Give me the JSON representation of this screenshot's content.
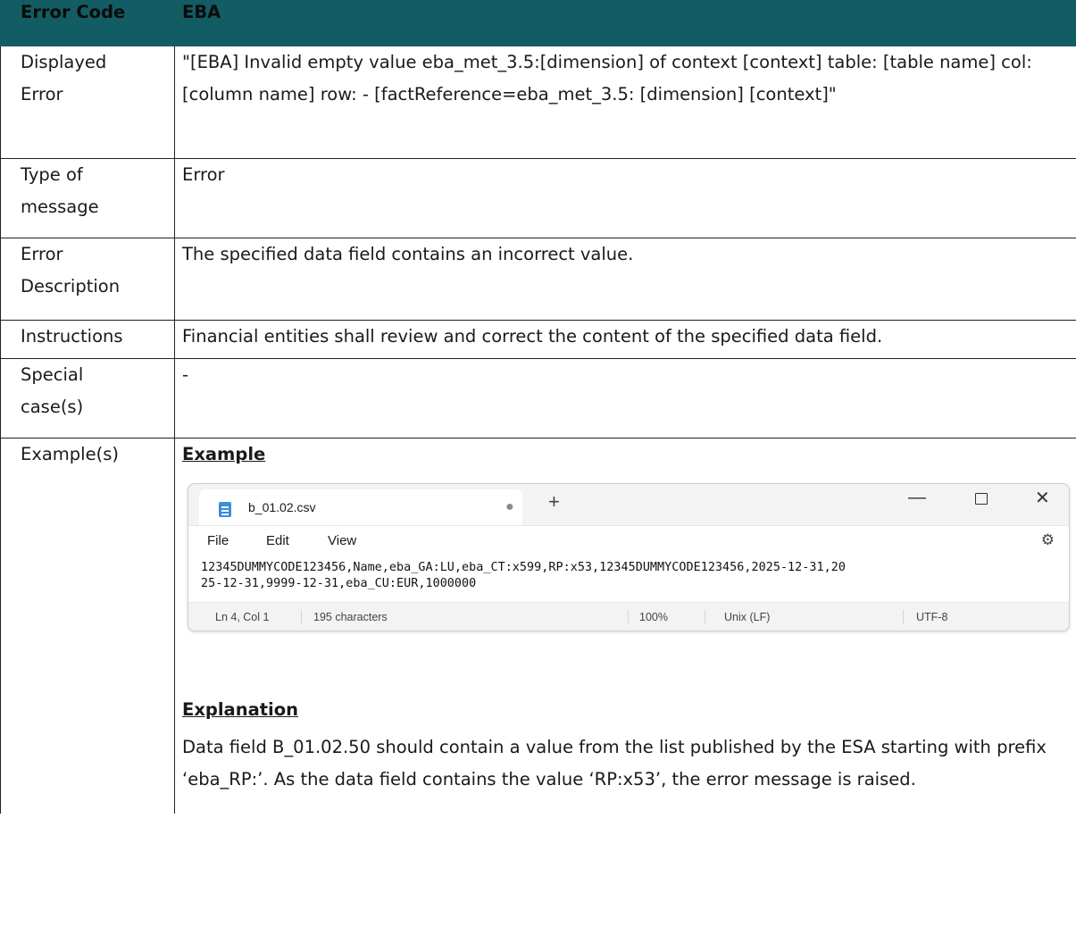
{
  "header": {
    "col1": "Error Code",
    "col2": "EBA"
  },
  "rows": {
    "displayed_error": {
      "label_line1": "Displayed",
      "label_line2": "Error",
      "value": "\"[EBA] Invalid empty value eba_met_3.5:[dimension] of context [context] table: [table name] col: [column name] row: - [factReference=eba_met_3.5: [dimension] [context]\""
    },
    "type_of_message": {
      "label_line1": "Type of",
      "label_line2": "message",
      "value": "Error"
    },
    "error_description": {
      "label_line1": "Error",
      "label_line2": "Description",
      "value": "The specified data field contains an incorrect value."
    },
    "instructions": {
      "label": "Instructions",
      "value": "Financial entities shall review and correct the content of the specified data field."
    },
    "special_cases": {
      "label_line1": "Special",
      "label_line2": "case(s)",
      "value": "-"
    },
    "examples": {
      "label": "Example(s)",
      "example_heading": "Example",
      "explanation_heading": "Explanation",
      "explanation_text": "Data field B_01.02.50 should contain a value from the list published by the ESA starting with prefix ‘eba_RP:’.  As the data field contains the value ‘RP:x53’, the error message is raised."
    }
  },
  "notepad": {
    "tab_title": "b_01.02.csv",
    "tab_dot": "●",
    "new_tab": "+",
    "window_min": "—",
    "window_close": "✕",
    "menu": [
      "File",
      "Edit",
      "View"
    ],
    "gear_icon": "⚙",
    "content_line1": "12345DUMMYCODE123456,Name,eba_GA:LU,eba_CT:x599,RP:x53,12345DUMMYCODE123456,2025-12-31,20",
    "content_line2": "25-12-31,9999-12-31,eba_CU:EUR,1000000",
    "status": {
      "position": "Ln 4, Col 1",
      "chars": "195 characters",
      "zoom": "100%",
      "line_ending": "Unix (LF)",
      "encoding": "UTF-8"
    }
  },
  "colors": {
    "header_bg": "#125d63"
  }
}
